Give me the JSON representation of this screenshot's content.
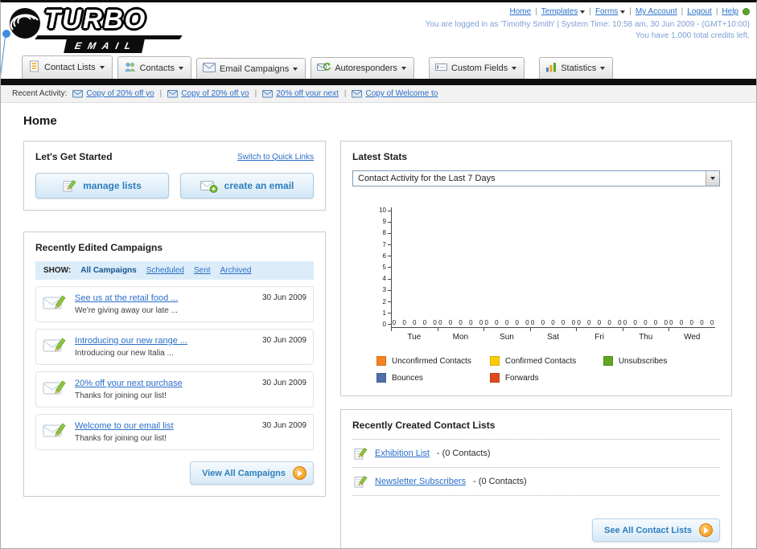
{
  "header": {
    "logo_line1": "TURBO",
    "logo_line2": "EMAIL",
    "separator": "|",
    "links": [
      "Home",
      "Templates",
      "Forms",
      "My Account",
      "Logout",
      "Help"
    ],
    "login_info": "You are logged in as 'Timothy Smith' | System Time: 10:58 am, 30 Jun 2009 - (GMT+10:00)",
    "credits": "You have 1,000 total credits left."
  },
  "nav": {
    "tabs": [
      {
        "label": "Contact Lists"
      },
      {
        "label": "Contacts"
      },
      {
        "label": "Email Campaigns"
      },
      {
        "label": "Autoresponders"
      },
      {
        "label": "Custom Fields"
      },
      {
        "label": "Statistics"
      }
    ]
  },
  "recent_activity": {
    "label": "Recent Activity:",
    "separator": "|",
    "items": [
      "Copy of 20% off yo",
      "Copy of 20% off yo",
      "20% off your next",
      "Copy of Welcome to"
    ]
  },
  "page_title": "Home",
  "get_started": {
    "title": "Let's Get Started",
    "switch_link": "Switch to Quick Links",
    "manage_button": "manage lists",
    "create_button": "create an email"
  },
  "campaigns": {
    "title": "Recently Edited Campaigns",
    "show_label": "SHOW:",
    "tabs": [
      "All Campaigns",
      "Scheduled",
      "Sent",
      "Archived"
    ],
    "items": [
      {
        "title": "See us at the retail food ...",
        "subtitle": "We're giving away our late ...",
        "date": "30 Jun 2009"
      },
      {
        "title": "Introducing our new range ...",
        "subtitle": "Introducing our new Italia ...",
        "date": "30 Jun 2009"
      },
      {
        "title": "20% off your next purchase",
        "subtitle": "Thanks for joining our list!",
        "date": "30 Jun 2009"
      },
      {
        "title": "Welcome to our email list",
        "subtitle": "Thanks for joining our list!",
        "date": "30 Jun 2009"
      }
    ],
    "view_all_button": "View All Campaigns"
  },
  "stats": {
    "title": "Latest Stats",
    "selected_option": "Contact Activity for the Last 7 Days",
    "chart_data": {
      "type": "bar",
      "title": "Contact Activity for the Last 7 Days",
      "categories": [
        "Tue",
        "Mon",
        "Sun",
        "Sat",
        "Fri",
        "Thu",
        "Wed"
      ],
      "series": [
        {
          "name": "Unconfirmed Contacts",
          "color": "#F58220",
          "values": [
            0,
            0,
            0,
            0,
            0,
            0,
            0
          ]
        },
        {
          "name": "Confirmed Contacts",
          "color": "#FFCC00",
          "values": [
            0,
            0,
            0,
            0,
            0,
            0,
            0
          ]
        },
        {
          "name": "Unsubscribes",
          "color": "#61A521",
          "values": [
            0,
            0,
            0,
            0,
            0,
            0,
            0
          ]
        },
        {
          "name": "Bounces",
          "color": "#4F6FA8",
          "values": [
            0,
            0,
            0,
            0,
            0,
            0,
            0
          ]
        },
        {
          "name": "Forwards",
          "color": "#E0491E",
          "values": [
            0,
            0,
            0,
            0,
            0,
            0,
            0
          ]
        }
      ],
      "xlabel": "",
      "ylabel": "",
      "ylim": [
        0,
        10
      ],
      "grid": false,
      "legend_position": "bottom"
    }
  },
  "contact_lists": {
    "title": "Recently Created Contact Lists",
    "items": [
      {
        "name": "Exhibition List",
        "detail": "- (0 Contacts)"
      },
      {
        "name": "Newsletter Subscribers",
        "detail": "- (0 Contacts)"
      }
    ],
    "see_all_button": "See All Contact Lists"
  }
}
